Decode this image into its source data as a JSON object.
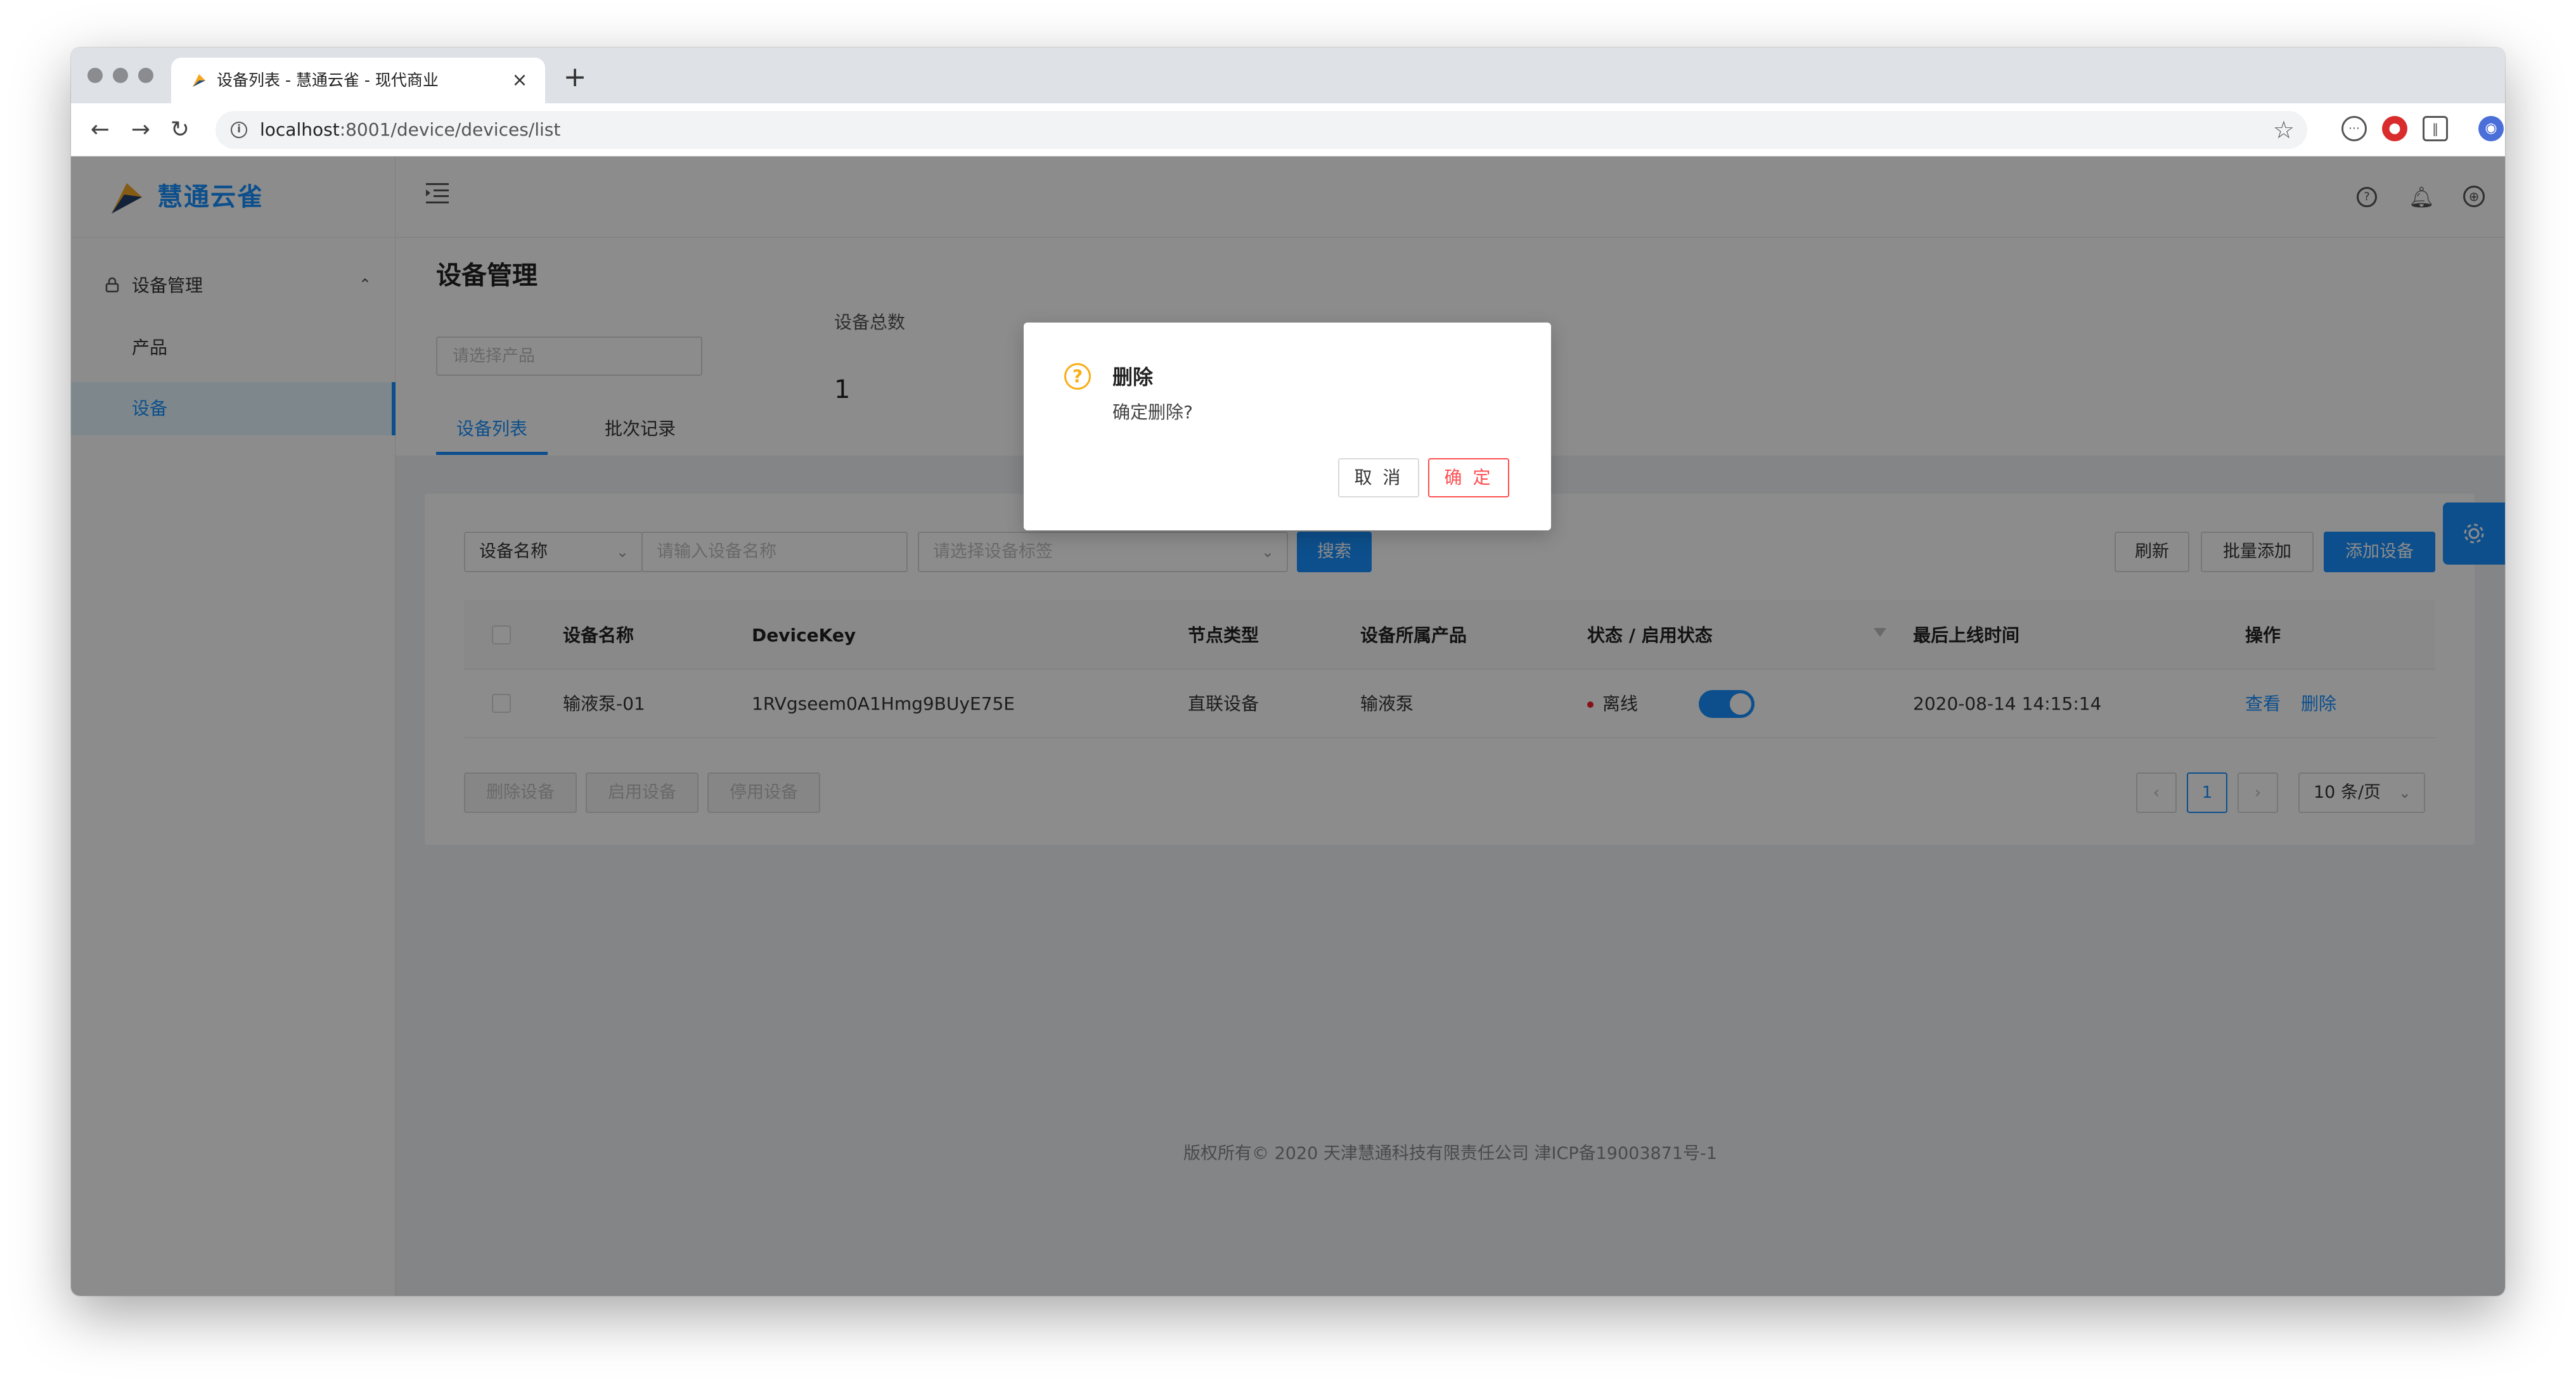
{
  "browser": {
    "tab_title": "设备列表 - 慧通云雀 - 现代商业",
    "url_host": "localhost",
    "url_rest": ":8001/device/devices/list"
  },
  "app": {
    "logo_text": "慧通云雀",
    "menu": {
      "group_label": "设备管理",
      "items": [
        {
          "label": "产品",
          "active": false
        },
        {
          "label": "设备",
          "active": true
        }
      ]
    }
  },
  "page": {
    "title": "设备管理",
    "product_select_placeholder": "请选择产品",
    "stat_label": "设备总数",
    "stat_value": "1",
    "tabs": [
      {
        "label": "设备列表",
        "active": true
      },
      {
        "label": "批次记录",
        "active": false
      }
    ]
  },
  "filters": {
    "field_select": "设备名称",
    "name_placeholder": "请输入设备名称",
    "tag_placeholder": "请选择设备标签",
    "search_label": "搜索"
  },
  "actions": {
    "refresh": "刷新",
    "batch_add": "批量添加",
    "add_device": "添加设备"
  },
  "table": {
    "columns": [
      "设备名称",
      "DeviceKey",
      "节点类型",
      "设备所属产品",
      "状态 / 启用状态",
      "最后上线时间",
      "操作"
    ],
    "rows": [
      {
        "name": "输液泵-01",
        "device_key": "1RVgseem0A1Hmg9BUyE75E",
        "node_type": "直联设备",
        "product": "输液泵",
        "status": "离线",
        "enabled": true,
        "last_online": "2020-08-14 14:15:14",
        "action_view": "查看",
        "action_delete": "删除"
      }
    ]
  },
  "bulk_actions": {
    "delete": "删除设备",
    "enable": "启用设备",
    "disable": "停用设备"
  },
  "pagination": {
    "current_page": "1",
    "page_size": "10 条/页"
  },
  "footer": {
    "text": "版权所有© 2020 天津慧通科技有限责任公司 津ICP备19003871号-1"
  },
  "modal": {
    "title": "删除",
    "content": "确定删除?",
    "cancel": "取 消",
    "confirm": "确 定"
  },
  "colors": {
    "primary": "#1890ff",
    "danger": "#ff4d4f",
    "warning": "#faad14",
    "offline_dot": "#f5222d"
  },
  "icons": [
    "back-arrow-icon",
    "forward-arrow-icon",
    "reload-icon",
    "info-icon",
    "bookmark-star-icon",
    "menu-fold-icon",
    "question-icon",
    "bell-icon",
    "globe-icon",
    "avatar",
    "settings-gear-icon",
    "question-circle-icon",
    "filter-icon"
  ]
}
